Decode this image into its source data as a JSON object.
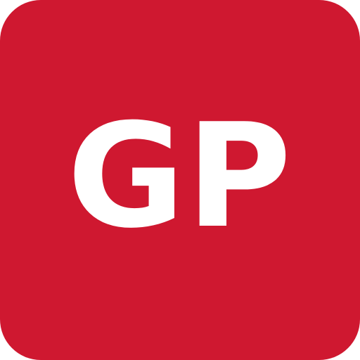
{
  "icon": {
    "monogram": "GP",
    "background_color": "#cf1830",
    "text_color": "#ffffff"
  }
}
